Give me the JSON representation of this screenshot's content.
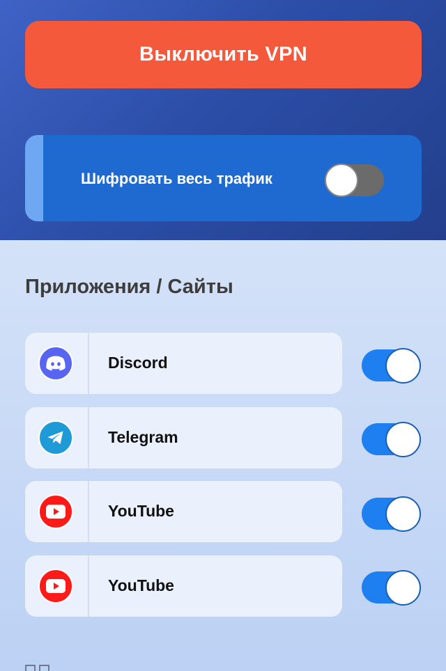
{
  "vpn_button": {
    "label": "Выключить VPN"
  },
  "encrypt_all": {
    "label": "Шифровать весь трафик",
    "enabled": false
  },
  "apps_section": {
    "title": "Приложения / Сайты"
  },
  "apps": [
    {
      "name": "Discord",
      "icon": "discord-icon",
      "enabled": true
    },
    {
      "name": "Telegram",
      "icon": "telegram-icon",
      "enabled": true
    },
    {
      "name": "YouTube",
      "icon": "youtube-icon",
      "enabled": true
    },
    {
      "name": "YouTube",
      "icon": "youtube-icon",
      "enabled": true
    }
  ],
  "colors": {
    "primary_button": "#f5593b",
    "card_blue": "#1f6ad0",
    "toggle_on": "#1d7ff0",
    "toggle_off": "#6b6b6b"
  }
}
